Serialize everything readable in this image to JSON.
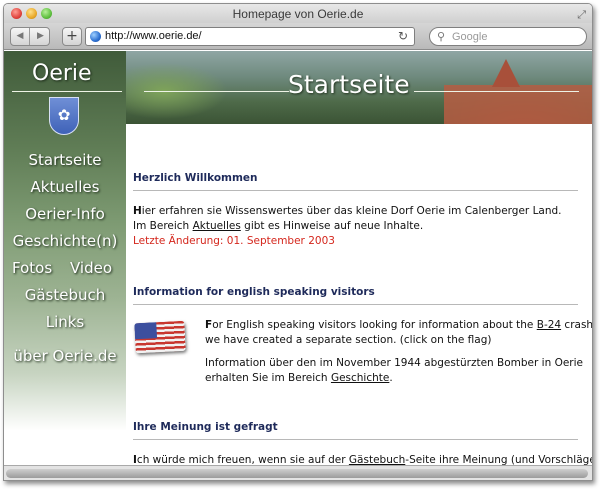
{
  "window": {
    "title": "Homepage von Oerie.de"
  },
  "toolbar": {
    "back_icon": "back-arrow-icon",
    "forward_icon": "forward-arrow-icon",
    "add_label": "+",
    "url": "http://www.oerie.de/",
    "reload_glyph": "↻",
    "search_placeholder": "Google"
  },
  "banner": {
    "title": "Startseite"
  },
  "sidebar": {
    "site_name": "Oerie",
    "items": [
      {
        "label": "Startseite"
      },
      {
        "label": "Aktuelles"
      },
      {
        "label": "Oerier-Info"
      },
      {
        "label": "Geschichte(n)"
      },
      {
        "label": "Fotos"
      },
      {
        "label": "Video"
      },
      {
        "label": "Gästebuch"
      },
      {
        "label": "Links"
      },
      {
        "label": "über Oerie.de"
      }
    ]
  },
  "content": {
    "welcome": {
      "heading": "Herzlich Willkommen",
      "line1_first": "H",
      "line1_rest": "ier erfahren sie Wissenswertes über das kleine Dorf Oerie im Calenberger Land.",
      "line2_before": "Im Bereich ",
      "line2_link": "Aktuelles",
      "line2_after": " gibt es Hinweise auf neue Inhalte.",
      "last_change": "Letzte Änderung: 01. September 2003"
    },
    "english": {
      "heading": "Information for english speaking visitors",
      "p1_first": "F",
      "p1_rest_a": "or English speaking visitors looking for information about the ",
      "p1_link": "B-24",
      "p1_rest_b": " crash",
      "p1_line2": "we have created a separate section. (click on the flag)",
      "p2_line1": "Information über den im November 1944 abgestürzten Bomber in Oerie",
      "p2_before": "erhalten Sie im Bereich ",
      "p2_link": "Geschichte",
      "p2_after": "."
    },
    "opinion": {
      "heading": "Ihre Meinung ist gefragt",
      "line_first": "I",
      "line_before": "ch würde mich freuen, wenn sie auf der ",
      "line_link": "Gästebuch",
      "line_after": "-Seite ihre Meinung (und Vorschläge)"
    }
  },
  "colors": {
    "heading": "#1e2a5a",
    "last_change": "#d4261c",
    "nav_text": "#ffffff"
  }
}
